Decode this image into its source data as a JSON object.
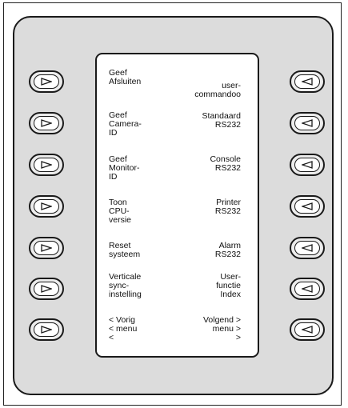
{
  "left_labels": [
    "Geef\nAfsluiten",
    "Geef\nCamera-\nID",
    "Geef\nMonitor-\nID",
    "Toon\nCPU-\nversie",
    "Reset\nsysteem",
    "Verticale\nsync-\ninstelling",
    "< Vorig\n< menu\n<"
  ],
  "right_labels": [
    "user-\ncommandoo",
    "Standaard\nRS232",
    "Console\nRS232",
    "Printer\nRS232",
    "Alarm\nRS232",
    "User-\nfunctie\nIndex",
    "Volgend >\nmenu >\n>"
  ],
  "icons": {
    "left_buttons": "triangle-right-icon",
    "right_buttons": "triangle-left-icon"
  }
}
